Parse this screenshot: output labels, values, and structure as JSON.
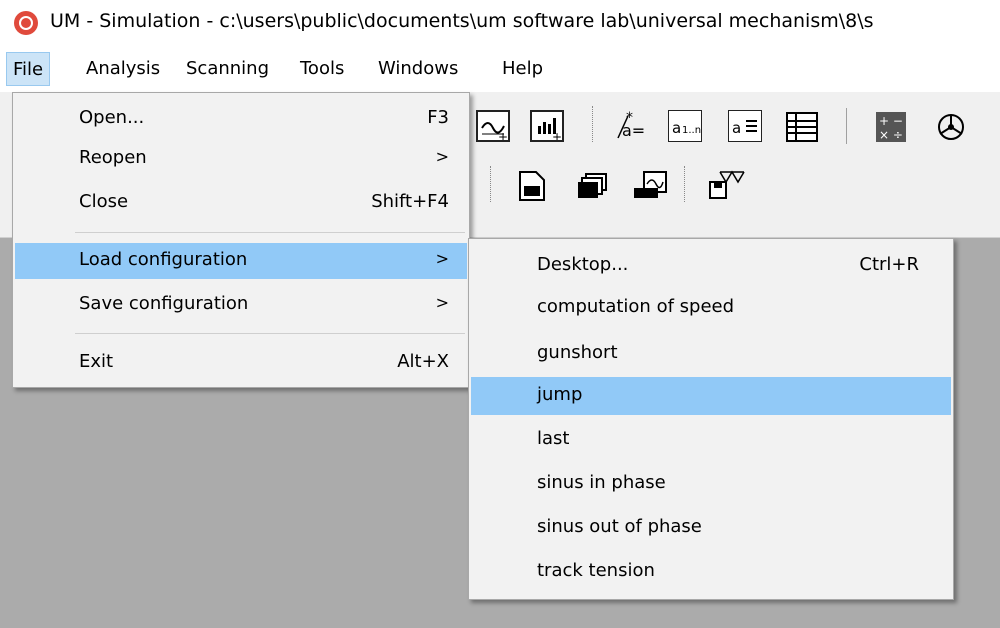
{
  "window": {
    "title": "UM - Simulation - c:\\users\\public\\documents\\um software lab\\universal mechanism\\8\\s",
    "icon": "um-app-icon"
  },
  "menubar": {
    "items": [
      {
        "label": "File",
        "active": true
      },
      {
        "label": "Analysis"
      },
      {
        "label": "Scanning"
      },
      {
        "label": "Tools"
      },
      {
        "label": "Windows"
      },
      {
        "label": "Help"
      }
    ]
  },
  "file_menu": {
    "items": [
      {
        "label": "Open...",
        "shortcut": "F3"
      },
      {
        "label": "Reopen",
        "arrow": ">"
      },
      {
        "label": "Close",
        "shortcut": "Shift+F4"
      },
      {
        "label": "Load configuration",
        "arrow": ">",
        "highlighted": true
      },
      {
        "label": "Save configuration",
        "arrow": ">"
      },
      {
        "label": "Exit",
        "shortcut": "Alt+X"
      }
    ]
  },
  "load_config_submenu": {
    "items": [
      {
        "label": "Desktop...",
        "shortcut": "Ctrl+R"
      },
      {
        "label": "computation of speed"
      },
      {
        "label": "gunshort"
      },
      {
        "label": "jump",
        "highlighted": true
      },
      {
        "label": "last"
      },
      {
        "label": "sinus in phase"
      },
      {
        "label": "sinus out of phase"
      },
      {
        "label": "track tension"
      }
    ]
  },
  "toolbar": {
    "row1_icons": [
      "add-graph-icon",
      "add-bar-chart-icon",
      "variable-wizard-icon",
      "array-variable-icon",
      "variable-list-icon",
      "table-icon",
      "calculator-icon",
      "mechanism-icon"
    ],
    "row2_icons": [
      "document-icon",
      "stacked-windows-icon",
      "graph-window-icon",
      "save-scene-icon"
    ]
  },
  "colors": {
    "highlight": "#91c9f7",
    "menu_active": "#cce4f7",
    "workspace": "#ababab",
    "menu_bg": "#f2f2f2"
  }
}
